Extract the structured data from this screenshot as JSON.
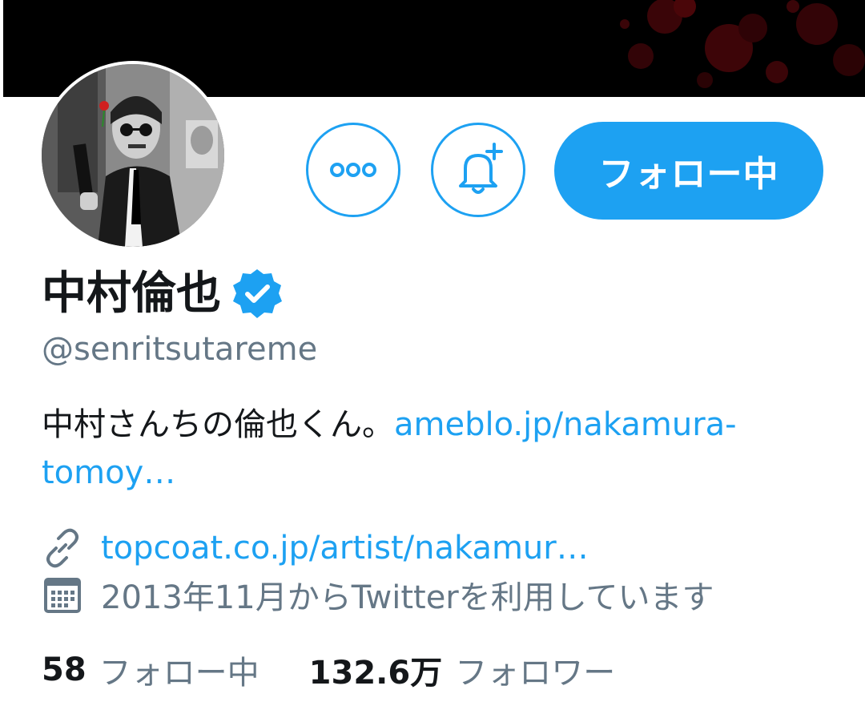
{
  "profile": {
    "display_name": "中村倫也",
    "handle": "@senritsutareme",
    "verified": true,
    "bio_text": "中村さんちの倫也くん。",
    "bio_link": "ameblo.jp/nakamura-tomoy…",
    "website": "topcoat.co.jp/artist/nakamur…",
    "joined": "2013年11月からTwitterを利用しています"
  },
  "actions": {
    "follow_label": "フォロー中"
  },
  "stats": {
    "following_count": "58",
    "following_label": "フォロー中",
    "followers_count": "132.6万",
    "followers_label": "フォロワー"
  },
  "colors": {
    "accent": "#1da1f2",
    "secondary_text": "#657786",
    "primary_text": "#14171a",
    "banner": "#000000"
  },
  "icons": {
    "more": "more-dots-icon",
    "notify": "bell-plus-icon",
    "verified": "verified-badge-icon",
    "website": "link-icon",
    "joined": "calendar-icon"
  }
}
